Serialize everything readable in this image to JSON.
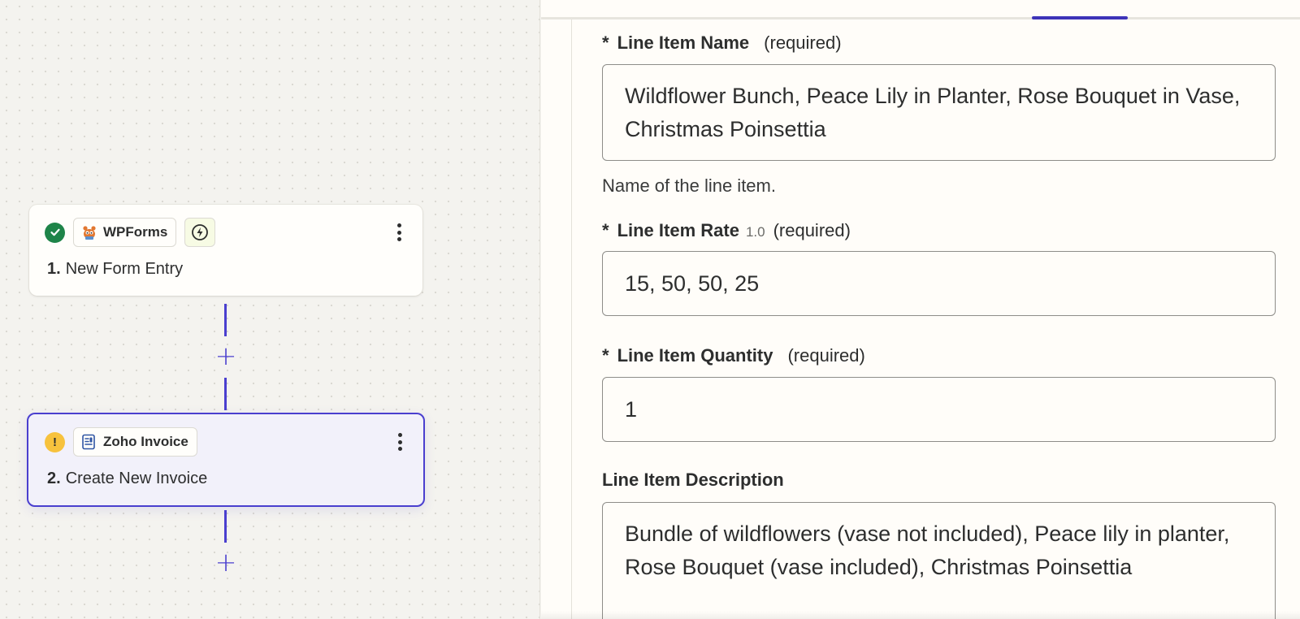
{
  "workflow": {
    "steps": [
      {
        "number": "1.",
        "title": "New Form Entry",
        "app": "WPForms",
        "status": "complete",
        "icons": [
          "check-circle-icon",
          "wpforms-logo-icon",
          "bolt-trigger-icon",
          "more-vertical-icon"
        ]
      },
      {
        "number": "2.",
        "title": "Create New Invoice",
        "app": "Zoho Invoice",
        "status": "warning",
        "status_glyph": "!",
        "icons": [
          "warning-circle-icon",
          "zoho-invoice-logo-icon",
          "more-vertical-icon"
        ]
      }
    ],
    "add_step_glyph": "+"
  },
  "form": {
    "line_item_name": {
      "required_marker": "*",
      "label": "Line Item Name",
      "required_text": "(required)",
      "value": "Wildflower Bunch, Peace Lily in Planter, Rose Bouquet in Vase, Christmas Poinsettia",
      "help": "Name of the line item."
    },
    "line_item_rate": {
      "required_marker": "*",
      "label": "Line Item Rate",
      "type_hint": "1.0",
      "required_text": "(required)",
      "value": "15, 50, 50, 25"
    },
    "line_item_quantity": {
      "required_marker": "*",
      "label": "Line Item Quantity",
      "required_text": "(required)",
      "value": "1"
    },
    "line_item_description": {
      "label": "Line Item Description",
      "value": "Bundle of wildflowers (vase not included), Peace lily in planter, Rose Bouquet (vase included), Christmas Poinsettia"
    }
  },
  "colors": {
    "accent": "#4a3fcf",
    "success": "#1e8449",
    "warning": "#f7c23d",
    "canvas_bg": "#f4f3ef",
    "panel_bg": "#fffdf9"
  }
}
